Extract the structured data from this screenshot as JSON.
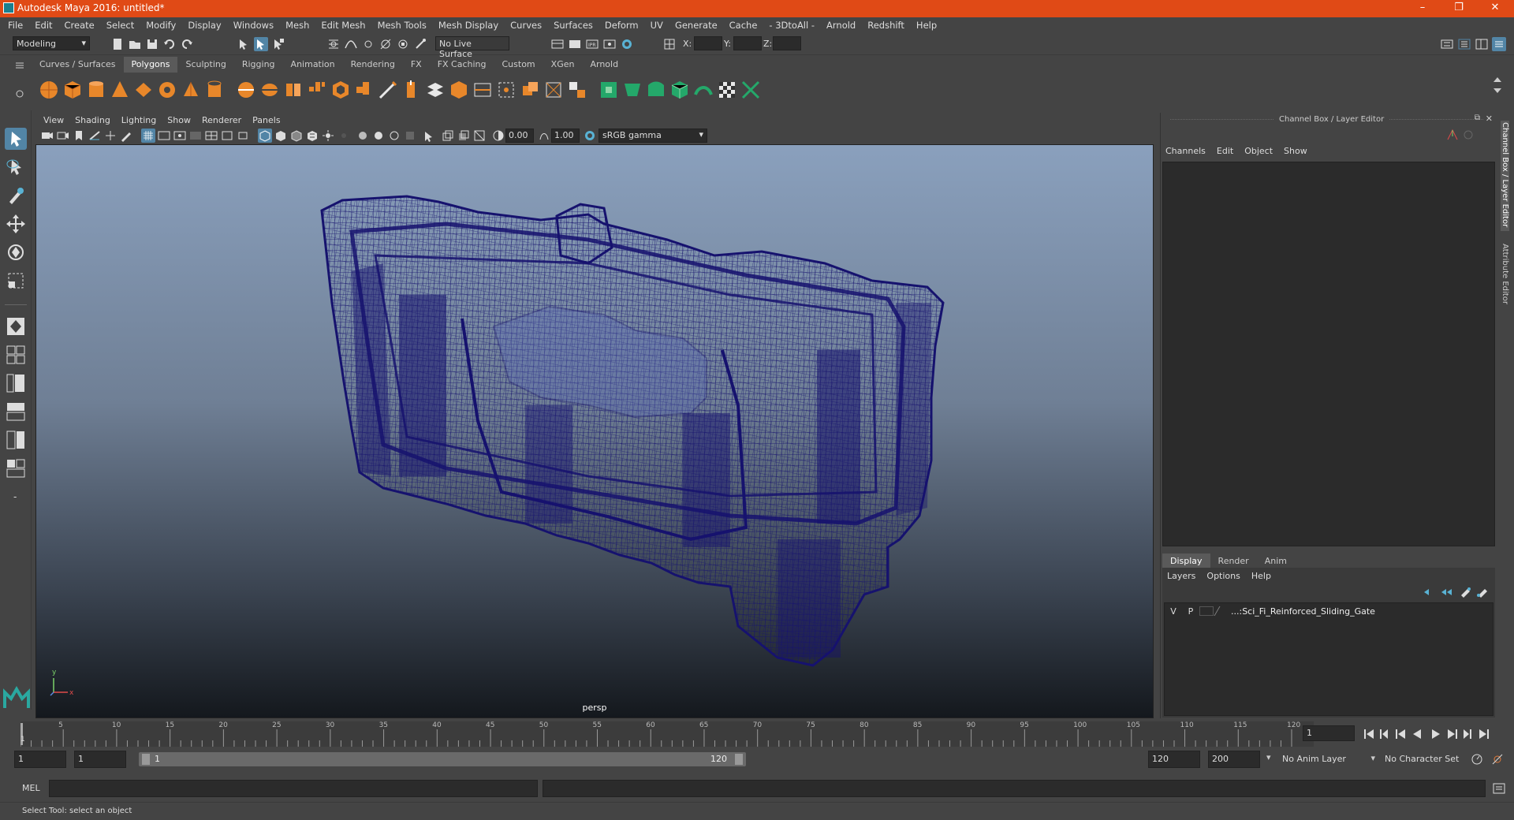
{
  "window": {
    "title": "Autodesk Maya 2016: untitled*",
    "minimize": "–",
    "restore": "❐",
    "close": "✕"
  },
  "menu": [
    "File",
    "Edit",
    "Create",
    "Select",
    "Modify",
    "Display",
    "Windows",
    "Mesh",
    "Edit Mesh",
    "Mesh Tools",
    "Mesh Display",
    "Curves",
    "Surfaces",
    "Deform",
    "UV",
    "Generate",
    "Cache",
    "- 3DtoAll -",
    "Arnold",
    "Redshift",
    "Help"
  ],
  "status_line": {
    "mode": "Modeling",
    "live_surface": "No Live Surface",
    "x_label": "X:",
    "y_label": "Y:",
    "z_label": "Z:"
  },
  "shelf_tabs": [
    "Curves / Surfaces",
    "Polygons",
    "Sculpting",
    "Rigging",
    "Animation",
    "Rendering",
    "FX",
    "FX Caching",
    "Custom",
    "XGen",
    "Arnold"
  ],
  "shelf_active": "Polygons",
  "viewport": {
    "menu": [
      "View",
      "Shading",
      "Lighting",
      "Show",
      "Renderer",
      "Panels"
    ],
    "exposure": "0.00",
    "gamma": "1.00",
    "color_space": "sRGB gamma",
    "camera_label": "persp",
    "axis_y": "y",
    "axis_x": "x"
  },
  "channel_box": {
    "title": "Channel Box / Layer Editor",
    "menu": [
      "Channels",
      "Edit",
      "Object",
      "Show"
    ]
  },
  "layer_editor": {
    "tabs": [
      "Display",
      "Render",
      "Anim"
    ],
    "active_tab": "Display",
    "menu": [
      "Layers",
      "Options",
      "Help"
    ],
    "layer": {
      "visible": "V",
      "playback": "P",
      "name": "...:Sci_Fi_Reinforced_Sliding_Gate"
    }
  },
  "side_tabs": [
    "Channel Box / Layer Editor",
    "Attribute Editor"
  ],
  "timeline": {
    "ticks": [
      "5",
      "10",
      "15",
      "20",
      "25",
      "30",
      "35",
      "40",
      "45",
      "50",
      "55",
      "60",
      "65",
      "70",
      "75",
      "80",
      "85",
      "90",
      "95",
      "100",
      "105",
      "110",
      "115",
      "120"
    ],
    "start_label": "1",
    "current_frame": "1"
  },
  "range": {
    "start": "1",
    "anim_start": "1",
    "range_start": "1",
    "range_end": "120",
    "anim_end_1": "120",
    "anim_end_2": "200",
    "anim_layer": "No Anim Layer",
    "char_set": "No Character Set"
  },
  "command_line": {
    "label": "MEL"
  },
  "help_line": "Select Tool: select an object",
  "colors": {
    "titlebar": "#e04a16",
    "wireframe": "#16126e",
    "accent": "#5285a6"
  }
}
